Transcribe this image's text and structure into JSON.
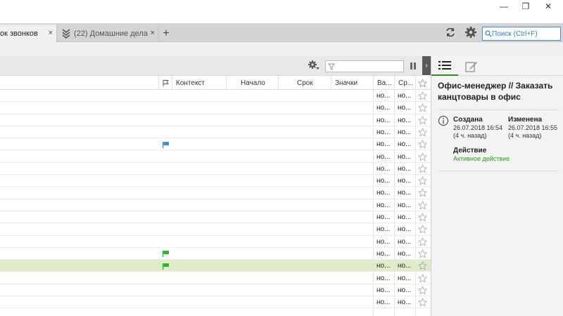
{
  "window": {
    "minimize": "—",
    "maximize": "❐",
    "close": "✕"
  },
  "tabs": [
    {
      "label": "ок звонков",
      "close": "×"
    },
    {
      "label": "(22) Домашние дела",
      "close": "×"
    }
  ],
  "add_tab": "+",
  "search": {
    "placeholder": "Поиск (Ctrl+F)"
  },
  "columns": [
    "Контекст",
    "Начало",
    "Срок",
    "Значки",
    "Ва...",
    "Ср..."
  ],
  "rows": [
    {
      "va": "но...",
      "sr": "но...",
      "flag": "",
      "selected": false
    },
    {
      "va": "но...",
      "sr": "но...",
      "flag": "",
      "selected": false
    },
    {
      "va": "но...",
      "sr": "но...",
      "flag": "",
      "selected": false
    },
    {
      "va": "но...",
      "sr": "но...",
      "flag": "",
      "selected": false
    },
    {
      "va": "но...",
      "sr": "но...",
      "flag": "blue",
      "selected": false
    },
    {
      "va": "но...",
      "sr": "но...",
      "flag": "",
      "selected": false
    },
    {
      "va": "но...",
      "sr": "но...",
      "flag": "",
      "selected": false
    },
    {
      "va": "но...",
      "sr": "но...",
      "flag": "",
      "selected": false
    },
    {
      "va": "но...",
      "sr": "но...",
      "flag": "",
      "selected": false
    },
    {
      "va": "но...",
      "sr": "но...",
      "flag": "",
      "selected": false
    },
    {
      "va": "но...",
      "sr": "но...",
      "flag": "",
      "selected": false
    },
    {
      "va": "но...",
      "sr": "но...",
      "flag": "",
      "selected": false
    },
    {
      "va": "но...",
      "sr": "но...",
      "flag": "",
      "selected": false
    },
    {
      "va": "но...",
      "sr": "но...",
      "flag": "green",
      "selected": false
    },
    {
      "va": "но...",
      "sr": "но...",
      "flag": "green",
      "selected": true
    },
    {
      "va": "но...",
      "sr": "но...",
      "flag": "",
      "selected": false
    },
    {
      "va": "но...",
      "sr": "но...",
      "flag": "",
      "selected": false
    },
    {
      "va": "но...",
      "sr": "но...",
      "flag": "",
      "selected": false
    }
  ],
  "colors": {
    "accent": "#2f8f1e",
    "flag_blue": "#3c8fd6",
    "flag_green": "#2db52d",
    "selected_row": "#dfeccb",
    "search_border": "#3c8fd6"
  },
  "detail": {
    "title": "Офис-менеджер // Заказать канцтовары в офис",
    "created_label": "Создана",
    "created_date": "26.07.2018 16:54",
    "created_ago": "(4 ч. назад)",
    "modified_label": "Изменена",
    "modified_date": "26.07.2018 16:55",
    "modified_ago": "(4 ч. назад)",
    "action_label": "Действие",
    "action_value": "Активное действие"
  },
  "panel_toggle": "›"
}
